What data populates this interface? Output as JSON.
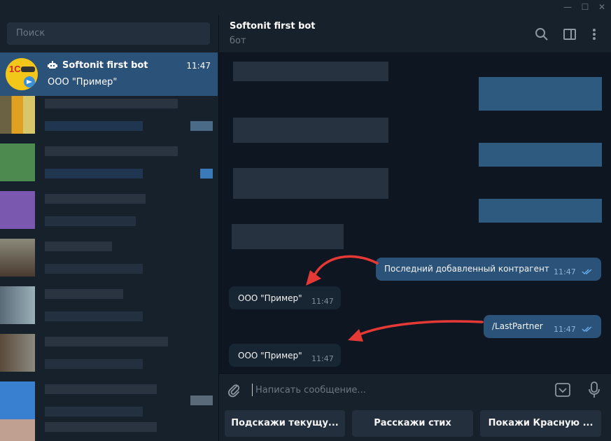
{
  "window": {
    "minimize": "—",
    "maximize": "☐",
    "close": "✕"
  },
  "sidebar": {
    "search_placeholder": "Поиск",
    "active_chat": {
      "name": "Softonit first bot",
      "time": "11:47",
      "preview": "ООО \"Пример\"",
      "avatar_text": "1С"
    }
  },
  "header": {
    "title": "Softonit first bot",
    "subtitle": "бот"
  },
  "messages": [
    {
      "dir": "out",
      "text": "Последний добавленный контрагент",
      "time": "11:47",
      "read": true
    },
    {
      "dir": "in",
      "text": "ООО \"Пример\"",
      "time": "11:47"
    },
    {
      "dir": "out",
      "text": "/LastPartner",
      "time": "11:47",
      "read": true
    },
    {
      "dir": "in",
      "text": "ООО \"Пример\"",
      "time": "11:47"
    }
  ],
  "composer": {
    "placeholder": "Написать сообщение..."
  },
  "keyboard": [
    "Подскажи текущу...",
    "Расскажи стих",
    "Покажи Красную ..."
  ],
  "colors": {
    "bg": "#0e1621",
    "panel": "#17212b",
    "active": "#2b5278",
    "bubble_in": "#182533",
    "bubble_out": "#2b5278",
    "arrow": "#e53935"
  }
}
